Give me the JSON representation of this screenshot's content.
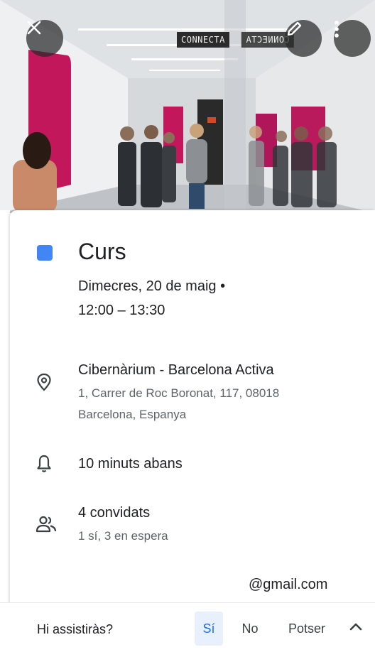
{
  "header": {
    "sign_text": "CONNECTA",
    "close_icon": "close-icon",
    "edit_icon": "pencil-icon",
    "more_icon": "more-vert-icon"
  },
  "event": {
    "color": "#4285f4",
    "title": "Curs",
    "date": "Dimecres, 20 de maig  •",
    "time": "12:00 – 13:30"
  },
  "location": {
    "icon": "location-pin-icon",
    "name": "Cibernàrium - Barcelona Activa",
    "address_line1": "1, Carrer de Roc Boronat, 117, 08018",
    "address_line2": "Barcelona, Espanya"
  },
  "reminder": {
    "icon": "bell-icon",
    "text": "10 minuts abans"
  },
  "guests": {
    "icon": "people-icon",
    "count_text": "4 convidats",
    "status_text": "1 sí, 3 en espera"
  },
  "organizer": {
    "email": "@gmail.com"
  },
  "rsvp": {
    "question": "Hi assistiràs?",
    "yes": "Sí",
    "no": "No",
    "maybe": "Potser",
    "selected": "yes",
    "toggle_icon": "chevron-up-icon"
  }
}
